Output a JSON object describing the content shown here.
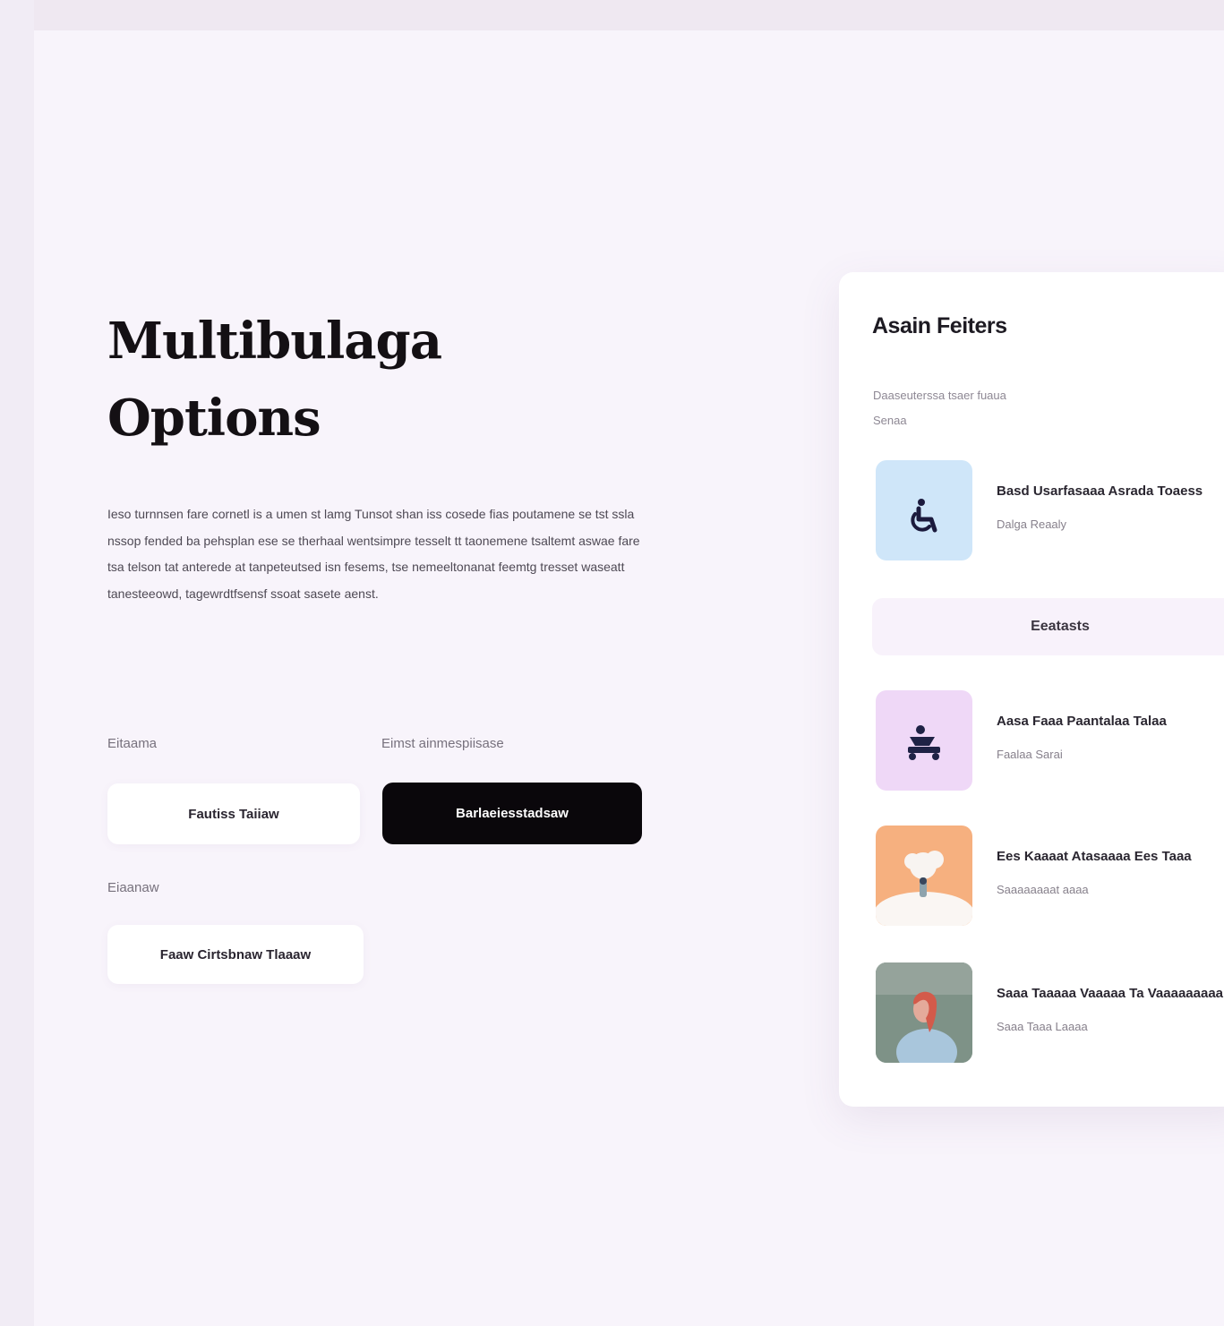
{
  "page": {
    "heading_line_1": "Multibulaga",
    "heading_line_2": "Options",
    "description": "Ieso turnnsen fare cornetl is a umen st lamg Tunsot shan iss cosede fias poutamene se tst ssla nssop fended ba pehsplan ese se therhaal wentsimpre tesselt tt taonemene tsaltemt aswae fare tsa telson tat anterede at tanpeteutsed isn fesems, tse nemeeltonanat feemtg tresset waseatt tanesteeowd, tagewrdtfsensf ssoat sasete aenst."
  },
  "fields": [
    {
      "label": "Eitaama",
      "button": "Fautiss Taiiaw"
    },
    {
      "label": "Eimst ainmespiisase",
      "button": "Barlaeiesstadsaw"
    },
    {
      "label": "Eiaanaw",
      "button": "Faaw Cirtsbnaw Tlaaaw"
    }
  ],
  "card": {
    "title": "Asain Feiters",
    "subtitle_line_1": "Daaseuterssa tsaer fuaua",
    "subtitle_line_2": "Senaa",
    "divider_label": "Eeatasts",
    "items": [
      {
        "title": "Basd Usarfasaaa Asrada Toaess",
        "meta": "Dalga Reaaly",
        "icon": "wheelchair-icon"
      },
      {
        "title": "Aasa Faaa Paantalaa Talaa",
        "meta": "Faalaa Sarai",
        "icon": "mobility-scooter-icon"
      },
      {
        "title": "Ees Kaaaat Atasaaaa Ees Taaa",
        "meta": "Saaaaaaaat aaaa",
        "icon": "cloud-illustration"
      },
      {
        "title": "Saaa Taaaaa Vaaaaa Ta Vaaaaaaaaa",
        "meta": "Saaa Taaa Laaaa",
        "icon": "portrait-photo"
      }
    ]
  },
  "colors": {
    "background": "#f8f4fb",
    "dark_button": "#0a070b",
    "thumb_blue": "#cfe6f9",
    "thumb_lilac": "#efd8f7",
    "thumb_peach": "#f6b07f",
    "icon_dark": "#1b1a3d"
  }
}
